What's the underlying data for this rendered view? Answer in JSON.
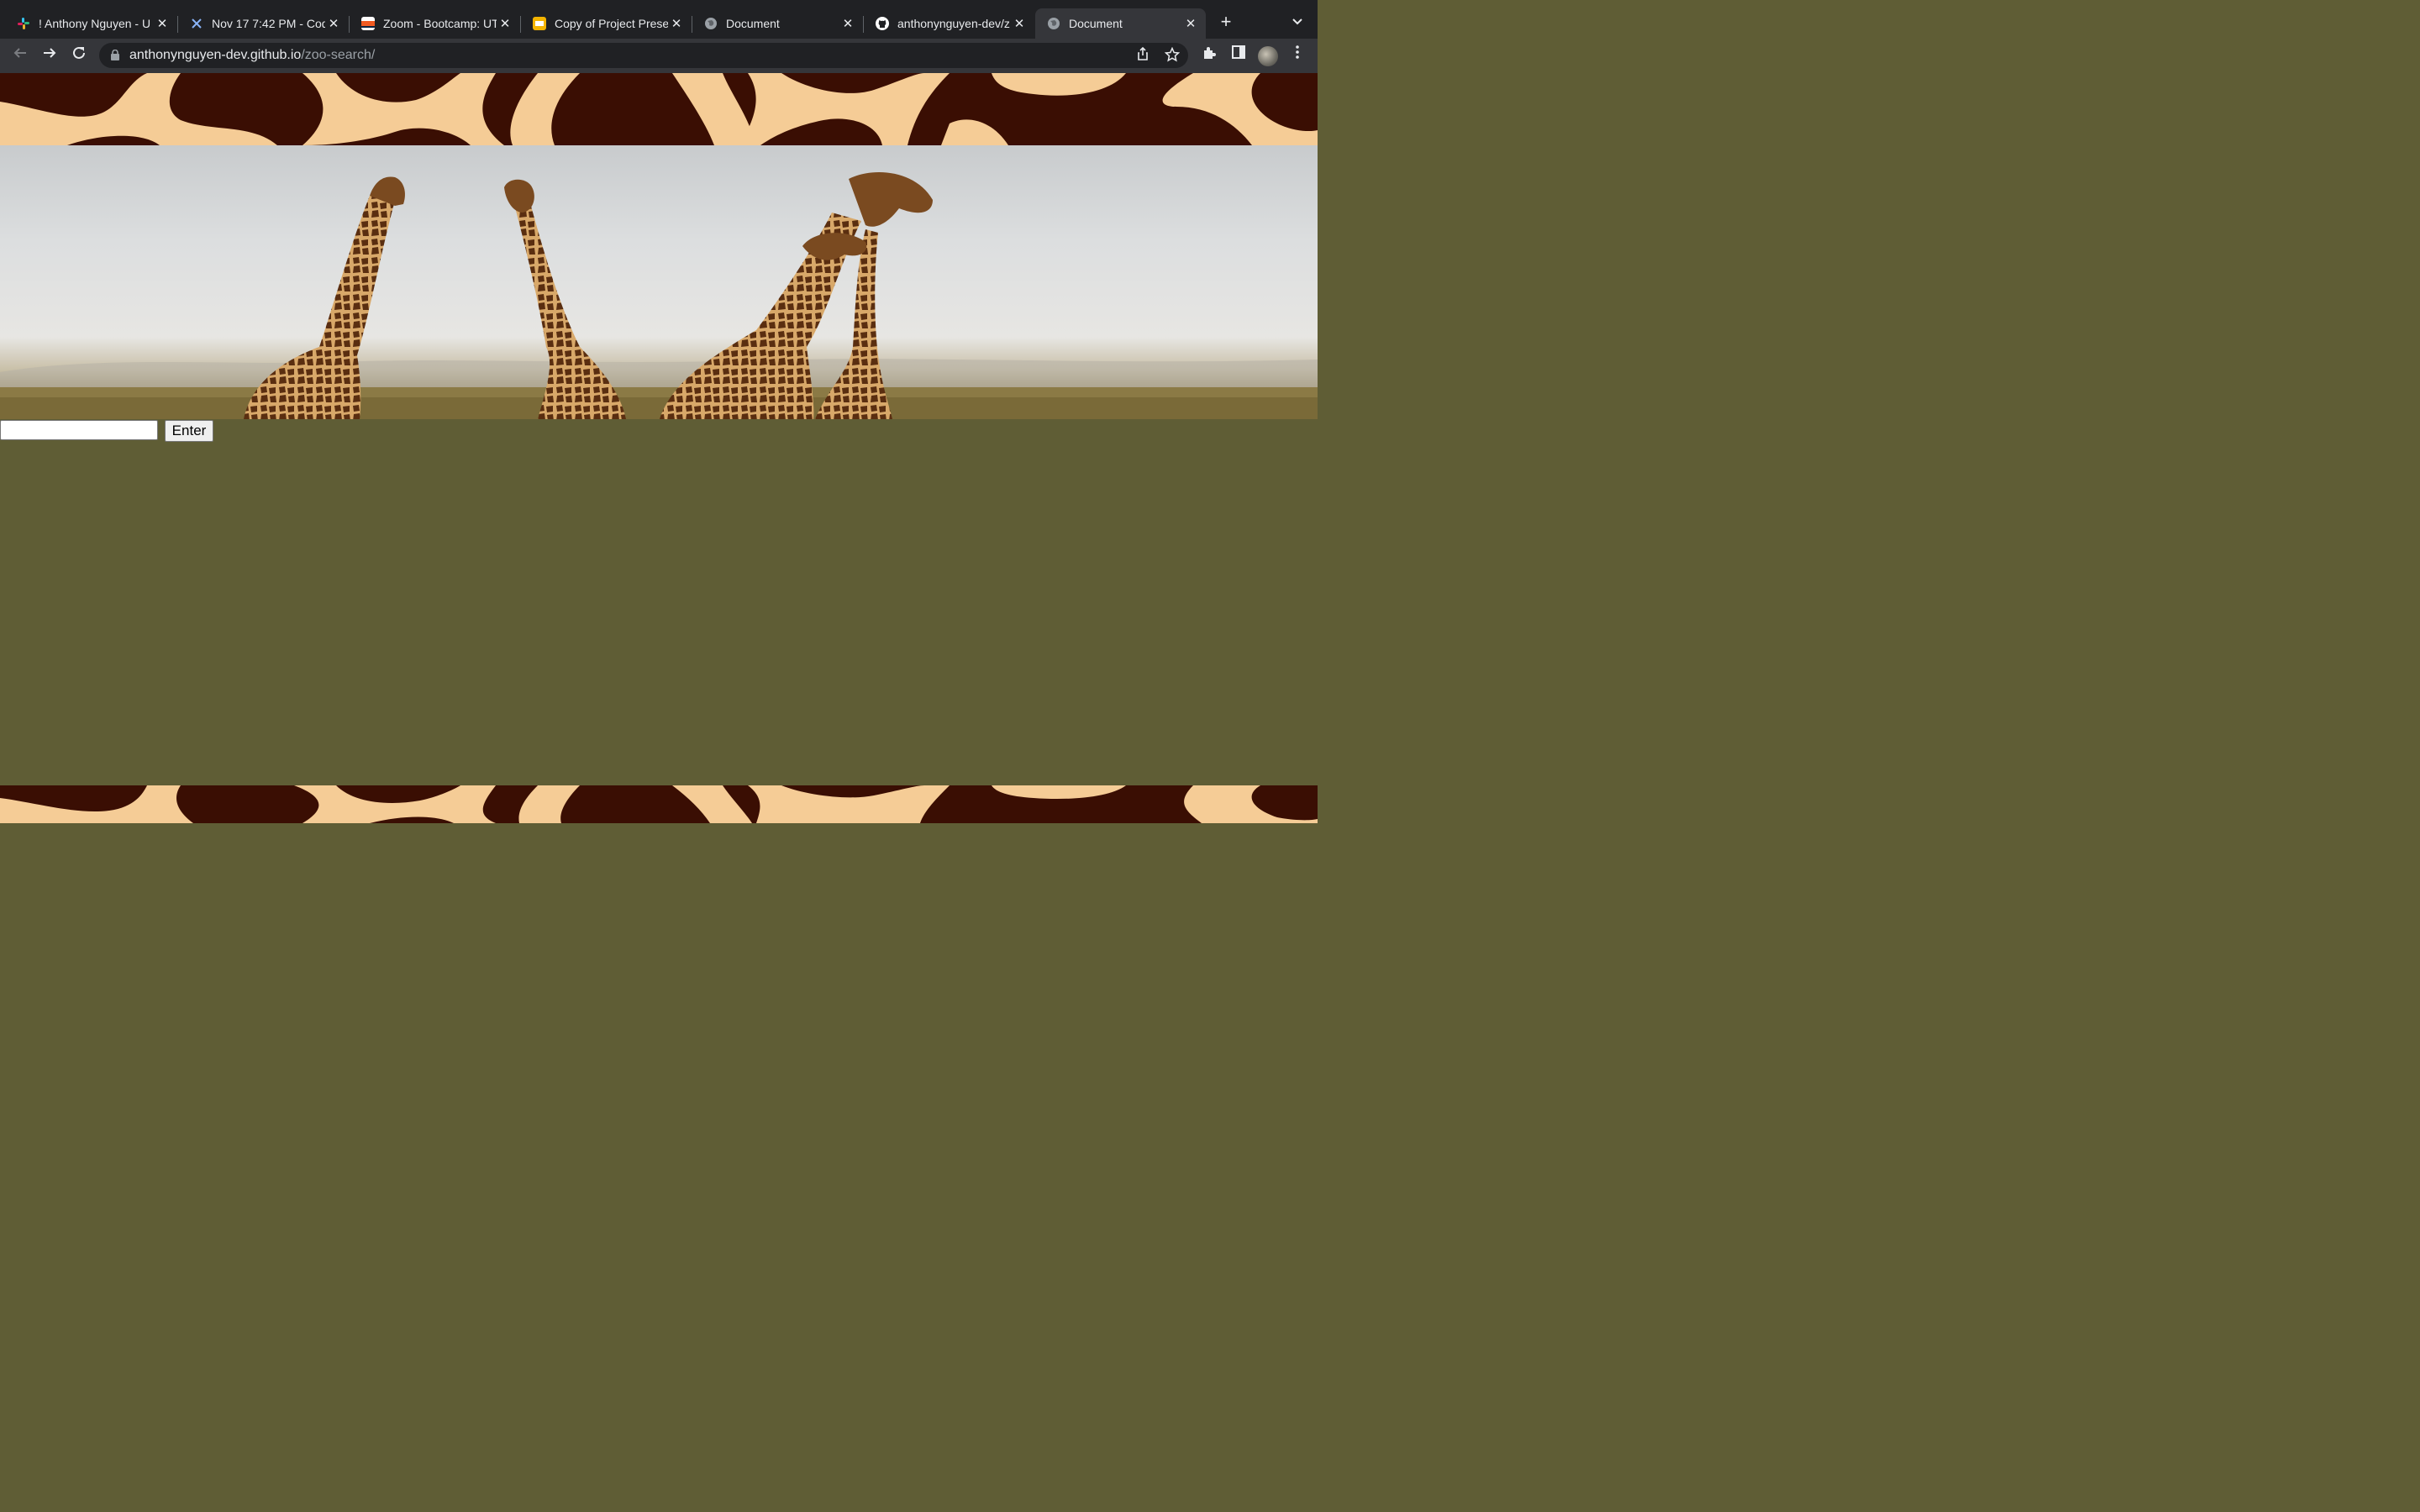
{
  "browser": {
    "tabs": [
      {
        "title": "! Anthony Nguyen - U",
        "favicon": "slack-icon",
        "active": false
      },
      {
        "title": "Nov 17 7:42 PM - Cod",
        "favicon": "sparkle-icon",
        "active": false
      },
      {
        "title": "Zoom - Bootcamp: UT",
        "favicon": "utsa-icon",
        "active": false
      },
      {
        "title": "Copy of Project Prese",
        "favicon": "slides-icon",
        "active": false
      },
      {
        "title": "Document",
        "favicon": "globe-icon",
        "active": false
      },
      {
        "title": "anthonynguyen-dev/z",
        "favicon": "github-icon",
        "active": false
      },
      {
        "title": "Document",
        "favicon": "globe-icon",
        "active": true
      }
    ],
    "address": {
      "host": "anthonynguyen-dev.github.io",
      "path": "/zoo-search/"
    }
  },
  "page": {
    "search": {
      "value": "",
      "placeholder": "",
      "button_label": "Enter"
    },
    "colors": {
      "background": "#5f5d35",
      "giraffe_dark": "#3a0e03",
      "giraffe_light": "#f5cc96"
    }
  }
}
